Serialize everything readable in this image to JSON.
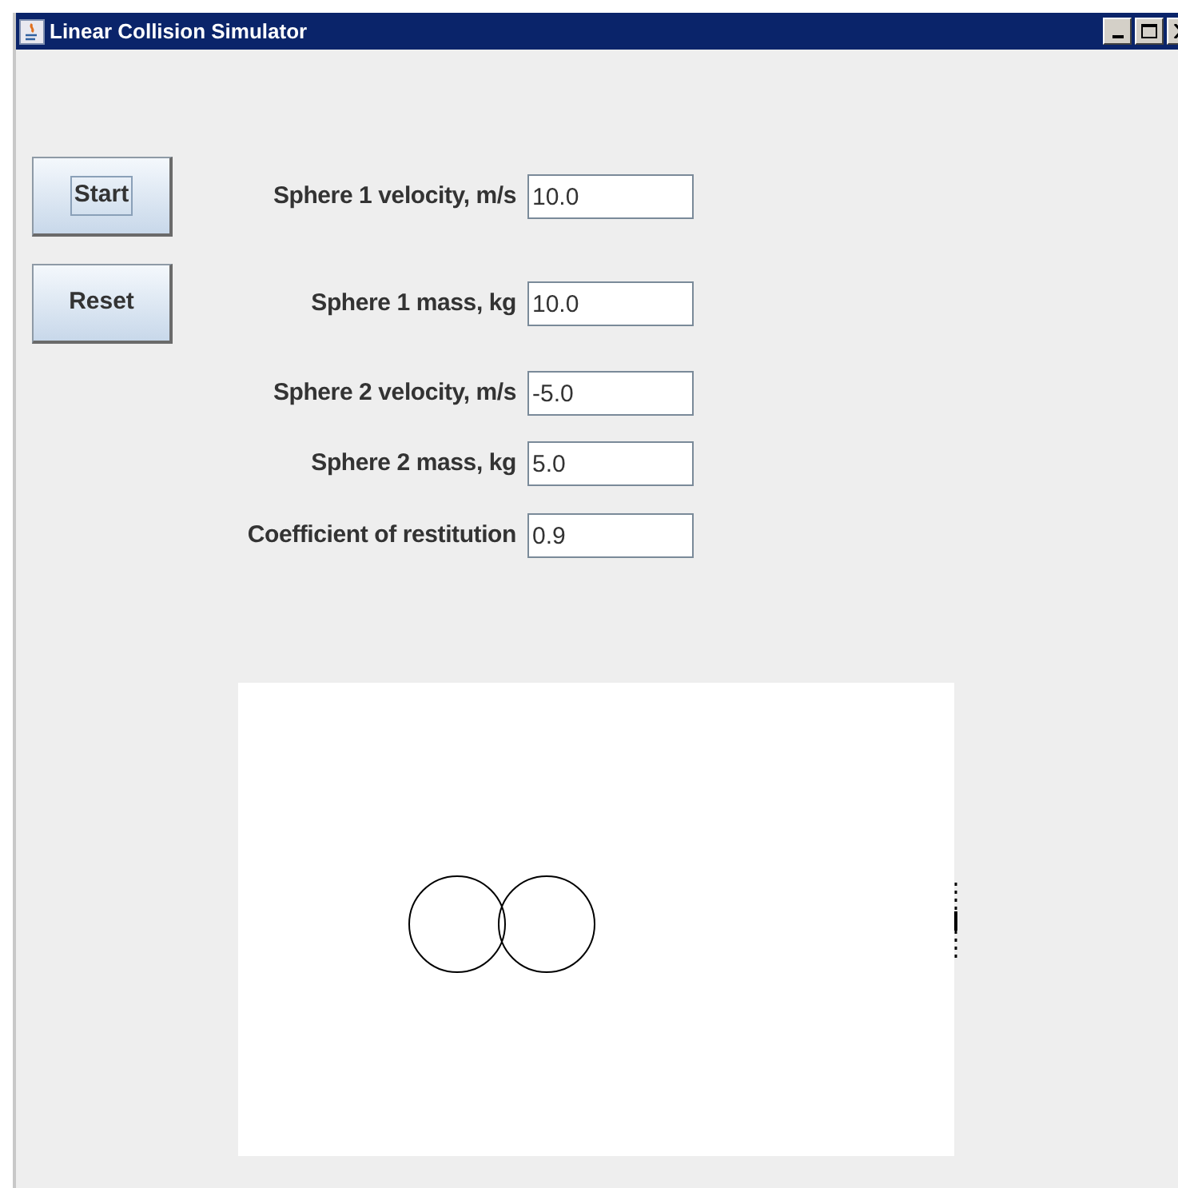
{
  "window": {
    "title": "Linear Collision Simulator"
  },
  "buttons": [
    {
      "label": "Start",
      "focused": true
    },
    {
      "label": "Reset",
      "focused": false
    }
  ],
  "fields": [
    {
      "label": "Sphere 1 velocity, m/s",
      "value": "10.0"
    },
    {
      "label": "Sphere 1 mass, kg",
      "value": "10.0"
    },
    {
      "label": "Sphere 2 velocity, m/s",
      "value": "-5.0"
    },
    {
      "label": "Sphere 2 mass, kg",
      "value": "5.0"
    },
    {
      "label": "Coefficient of restitution",
      "value": "0.9"
    }
  ]
}
